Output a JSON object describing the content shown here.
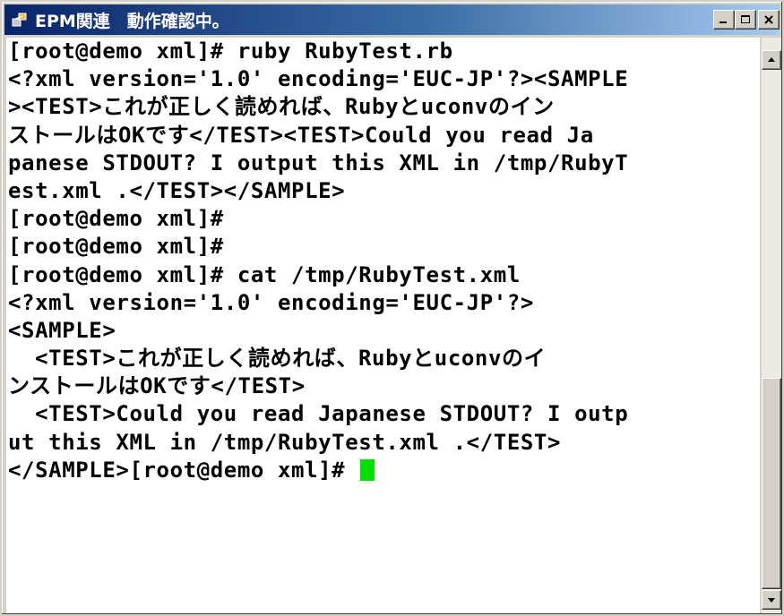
{
  "window": {
    "title": "EPM関連　動作確認中。"
  },
  "terminal": {
    "lines": [
      "[root@demo xml]# ruby RubyTest.rb",
      "<?xml version='1.0' encoding='EUC-JP'?><SAMPLE",
      "><TEST>これが正しく読めれば、Rubyとuconvのイン",
      "ストールはOKです</TEST><TEST>Could you read Ja",
      "panese STDOUT? I output this XML in /tmp/RubyT",
      "est.xml .</TEST></SAMPLE>",
      "[root@demo xml]#",
      "[root@demo xml]#",
      "[root@demo xml]# cat /tmp/RubyTest.xml",
      "<?xml version='1.0' encoding='EUC-JP'?>",
      "<SAMPLE>",
      "  <TEST>これが正しく読めれば、Rubyとuconvのイ",
      "ンストールはOKです</TEST>",
      "  <TEST>Could you read Japanese STDOUT? I outp",
      "ut this XML in /tmp/RubyTest.xml .</TEST>",
      "</SAMPLE>[root@demo xml]# "
    ],
    "cursor_color": "#00e000"
  },
  "colors": {
    "title_bar_start": "#0a246a",
    "title_bar_end": "#a6caf0",
    "terminal_background": "#ffffff",
    "terminal_text": "#000000"
  },
  "icons": {
    "app": "terminal-app-icon",
    "minimize": "minimize-icon",
    "maximize": "maximize-icon",
    "close": "close-icon",
    "scroll_up": "arrow-up-icon",
    "scroll_down": "arrow-down-icon"
  }
}
